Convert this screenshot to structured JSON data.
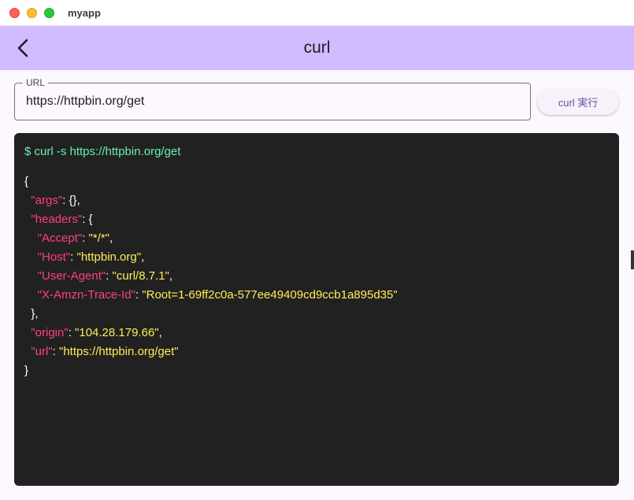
{
  "window": {
    "title": "myapp"
  },
  "appbar": {
    "title": "curl"
  },
  "url_field": {
    "label": "URL",
    "value": "https://httpbin.org/get"
  },
  "run_button": {
    "label": "curl 実行"
  },
  "terminal": {
    "command": "$ curl -s https://httpbin.org/get",
    "brace_open": "{",
    "args_key": "\"args\"",
    "args_value": "{}",
    "headers_key": "\"headers\"",
    "headers_open": "{",
    "accept_key": "\"Accept\"",
    "accept_value": "\"*/*\"",
    "host_key": "\"Host\"",
    "host_value": "\"httpbin.org\"",
    "ua_key": "\"User-Agent\"",
    "ua_value": "\"curl/8.7.1\"",
    "trace_key": "\"X-Amzn-Trace-Id\"",
    "trace_value": "\"Root=1-69ff2c0a-577ee49409cd9ccb1a895d35\"",
    "headers_close": "},",
    "origin_key": "\"origin\"",
    "origin_value": "\"104.28.179.66\"",
    "url_key": "\"url\"",
    "url_value": "\"https://httpbin.org/get\"",
    "brace_close": "}"
  },
  "colors": {
    "appbar": "#d0bcff",
    "terminal_bg": "#212121",
    "command": "#69f0ae",
    "json_key": "#ff4081",
    "json_value": "#ffee58",
    "button_text": "#6750a4"
  }
}
